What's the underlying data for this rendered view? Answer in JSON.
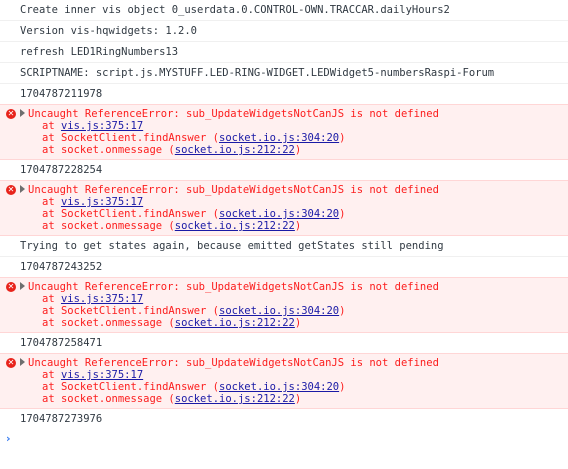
{
  "console": {
    "messages": [
      {
        "type": "log",
        "text": "Create inner vis object 0_userdata.0.CONTROL-OWN.TRACCAR.dailyHours2"
      },
      {
        "type": "log",
        "text": "Version vis-hqwidgets: 1.2.0"
      },
      {
        "type": "log",
        "text": "refresh LED1RingNumbers13"
      },
      {
        "type": "log",
        "text": "SCRIPTNAME: script.js.MYSTUFF.LED-RING-WIDGET.LEDWidget5-numbersRaspi-Forum"
      },
      {
        "type": "log",
        "text": "1704787211978"
      },
      {
        "type": "error",
        "text": "Uncaught ReferenceError: sub_UpdateWidgetsNotCanJS is not defined",
        "stack": [
          {
            "prefix": "at ",
            "link": "vis.js:375:17"
          },
          {
            "prefix": "at SocketClient.findAnswer (",
            "link": "socket.io.js:304:20",
            "suffix": ")"
          },
          {
            "prefix": "at socket.onmessage (",
            "link": "socket.io.js:212:22",
            "suffix": ")"
          }
        ]
      },
      {
        "type": "log",
        "text": "1704787228254"
      },
      {
        "type": "error",
        "text": "Uncaught ReferenceError: sub_UpdateWidgetsNotCanJS is not defined",
        "stack": [
          {
            "prefix": "at ",
            "link": "vis.js:375:17"
          },
          {
            "prefix": "at SocketClient.findAnswer (",
            "link": "socket.io.js:304:20",
            "suffix": ")"
          },
          {
            "prefix": "at socket.onmessage (",
            "link": "socket.io.js:212:22",
            "suffix": ")"
          }
        ]
      },
      {
        "type": "log",
        "text": "Trying to get states again, because emitted getStates still pending"
      },
      {
        "type": "log",
        "text": "1704787243252"
      },
      {
        "type": "error",
        "text": "Uncaught ReferenceError: sub_UpdateWidgetsNotCanJS is not defined",
        "stack": [
          {
            "prefix": "at ",
            "link": "vis.js:375:17"
          },
          {
            "prefix": "at SocketClient.findAnswer (",
            "link": "socket.io.js:304:20",
            "suffix": ")"
          },
          {
            "prefix": "at socket.onmessage (",
            "link": "socket.io.js:212:22",
            "suffix": ")"
          }
        ]
      },
      {
        "type": "log",
        "text": "1704787258471"
      },
      {
        "type": "error",
        "text": "Uncaught ReferenceError: sub_UpdateWidgetsNotCanJS is not defined",
        "stack": [
          {
            "prefix": "at ",
            "link": "vis.js:375:17"
          },
          {
            "prefix": "at SocketClient.findAnswer (",
            "link": "socket.io.js:304:20",
            "suffix": ")"
          },
          {
            "prefix": "at socket.onmessage (",
            "link": "socket.io.js:212:22",
            "suffix": ")"
          }
        ]
      },
      {
        "type": "log",
        "text": "1704787273976"
      }
    ],
    "error_icon_glyph": "✕",
    "prompt_glyph": "›"
  },
  "icons": {
    "error": "error-circle-icon",
    "expand": "expand-triangle-icon",
    "prompt": "prompt-chevron-icon"
  },
  "colors": {
    "error_text": "#fc1d1d",
    "error_background": "#fff0f0",
    "link": "#1a1aa6",
    "log_text": "#303942",
    "prompt": "#367cf1"
  }
}
